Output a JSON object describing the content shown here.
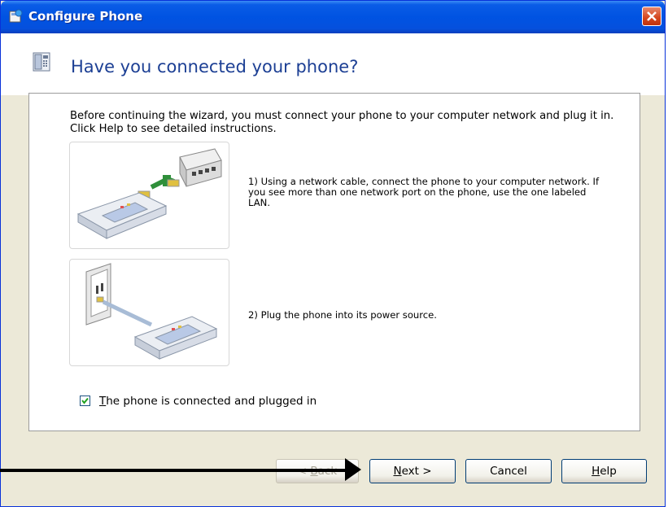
{
  "window": {
    "title": "Configure Phone",
    "close_label": "close"
  },
  "header": {
    "heading": "Have you connected your phone?"
  },
  "body": {
    "intro": "Before continuing the wizard, you must connect your phone to your computer network and plug it in. Click Help to see detailed instructions.",
    "steps": [
      {
        "text": "1) Using a network cable, connect the phone to your computer network. If you see more than one network port on the phone, use the one labeled LAN."
      },
      {
        "text": "2) Plug the phone into its power source."
      }
    ],
    "checkbox": {
      "label_first": "T",
      "label_rest": "he phone is connected and plugged in",
      "checked": true
    }
  },
  "buttons": {
    "back": {
      "underlined": "B",
      "prefix": "< ",
      "suffix": "ack"
    },
    "next": {
      "underlined": "N",
      "suffix": "ext >"
    },
    "cancel": {
      "label": "Cancel"
    },
    "help": {
      "underlined": "H",
      "suffix": "elp"
    }
  },
  "colors": {
    "titlebar": "#0053e2",
    "heading": "#1c3f94",
    "dialog_bg": "#ece9d8"
  },
  "icons": [
    "app-icon",
    "close-icon",
    "phone-icon",
    "network-illustration",
    "power-illustration",
    "checkmark-icon",
    "arrow-pointer"
  ]
}
